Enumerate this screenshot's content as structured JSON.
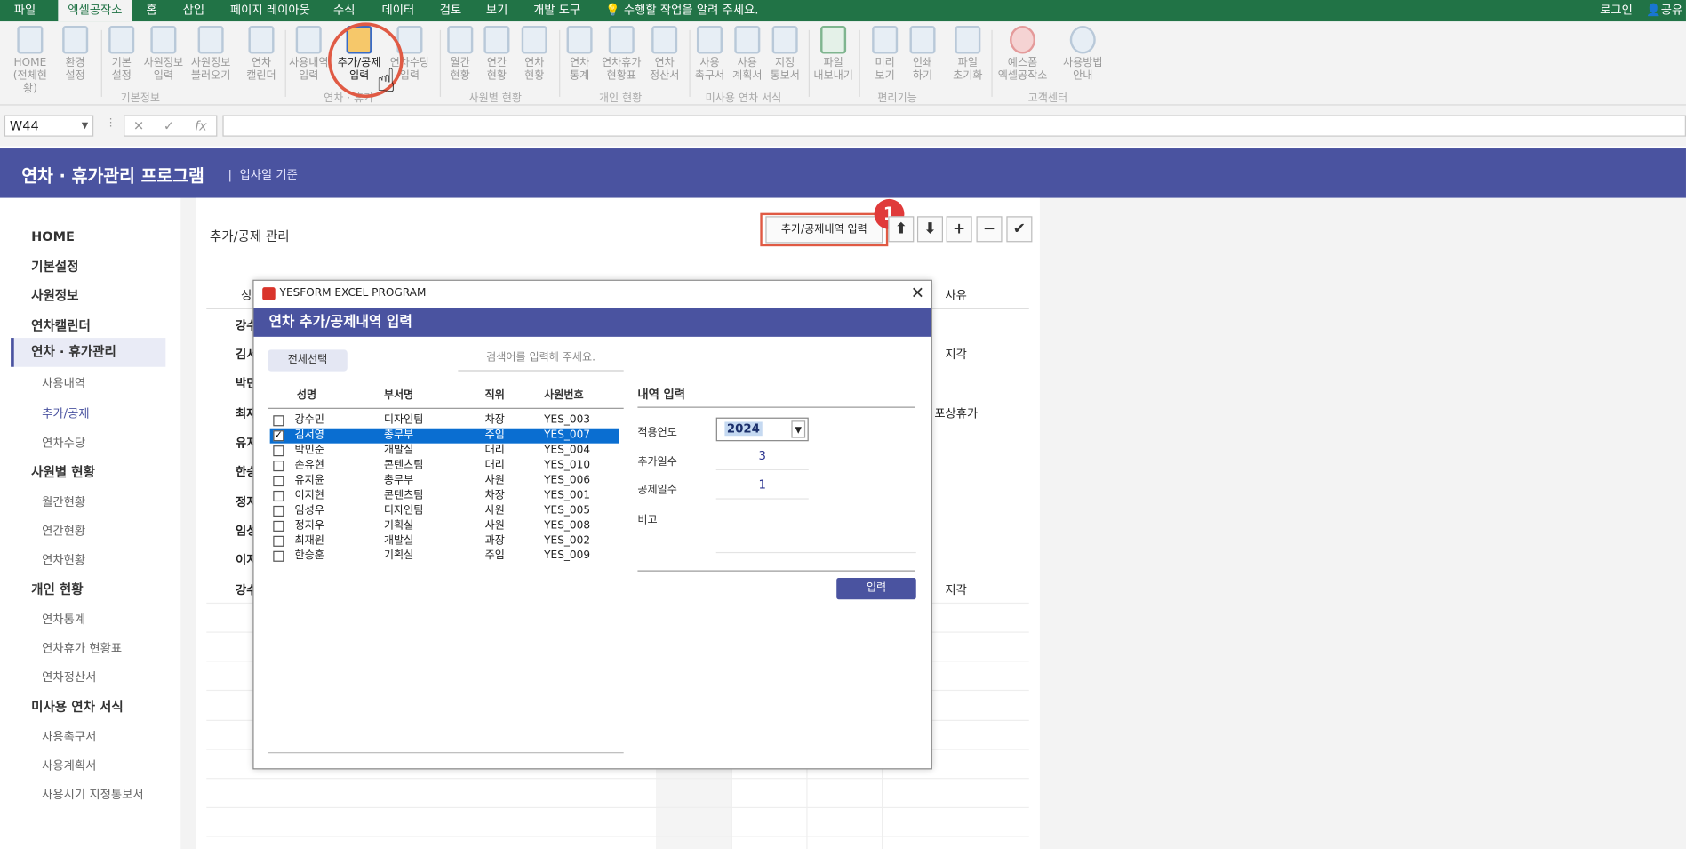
{
  "ribbon_tabs": [
    "파일",
    "엑셀공작소",
    "홈",
    "삽입",
    "페이지 레이아웃",
    "수식",
    "데이터",
    "검토",
    "보기",
    "개발 도구"
  ],
  "tell_me": "수행할 작업을 알려 주세요.",
  "login": "로그인",
  "share": "공유",
  "ribbon_buttons": [
    {
      "label": "HOME\n(전체현황)",
      "icon": "home-icon"
    },
    {
      "label": "환경\n설정",
      "icon": "gear-icon"
    },
    {
      "label": "기본\n설정",
      "icon": "settings-icon"
    },
    {
      "label": "사원정보\n입력",
      "icon": "users-icon"
    },
    {
      "label": "사원정보\n불러오기",
      "icon": "import-icon"
    },
    {
      "label": "연차\n캘린더",
      "icon": "calendar-icon"
    },
    {
      "label": "사용내역\n입력",
      "icon": "edit-icon"
    },
    {
      "label": "추가/공제\n입력",
      "icon": "edit-icon"
    },
    {
      "label": "연차수당\n입력",
      "icon": "edit-icon"
    },
    {
      "label": "월간\n현황",
      "icon": "table-icon"
    },
    {
      "label": "연간\n현황",
      "icon": "table-icon"
    },
    {
      "label": "연차\n현황",
      "icon": "users-icon"
    },
    {
      "label": "연차\n통계",
      "icon": "stats-icon"
    },
    {
      "label": "연차휴가\n현황표",
      "icon": "checklist-icon"
    },
    {
      "label": "연차\n정산서",
      "icon": "card-icon"
    },
    {
      "label": "사용\n촉구서",
      "icon": "doc-icon"
    },
    {
      "label": "사용\n계획서",
      "icon": "doc-icon"
    },
    {
      "label": "지정\n통보서",
      "icon": "doc-icon"
    },
    {
      "label": "파일\n내보내기",
      "icon": "excel-icon"
    },
    {
      "label": "미리\n보기",
      "icon": "preview-icon"
    },
    {
      "label": "인쇄\n하기",
      "icon": "print-icon"
    },
    {
      "label": "파일\n초기화",
      "icon": "trash-icon"
    },
    {
      "label": "예스폼\n엑셀공작소",
      "icon": "brand-icon"
    },
    {
      "label": "사용방법\n안내",
      "icon": "info-icon"
    }
  ],
  "ribbon_groups": [
    "기본정보",
    "연차 · 휴가",
    "사원별 현황",
    "개인 현황",
    "미사용 연차 서식",
    "편리기능",
    "고객센터"
  ],
  "name_box": "W44",
  "banner": {
    "title": "연차 · 휴가관리 프로그램",
    "sep": "|",
    "subtitle": "입사일 기준"
  },
  "sidebar": [
    {
      "label": "HOME",
      "level": 1
    },
    {
      "label": "기본설정",
      "level": 1
    },
    {
      "label": "사원정보",
      "level": 1
    },
    {
      "label": "연차캘린더",
      "level": 1
    },
    {
      "label": "연차 · 휴가관리",
      "level": 1,
      "selected": true
    },
    {
      "label": "사용내역",
      "level": 2
    },
    {
      "label": "추가/공제",
      "level": 2
    },
    {
      "label": "연차수당",
      "level": 2
    },
    {
      "label": "사원별 현황",
      "level": 1
    },
    {
      "label": "월간현황",
      "level": 2
    },
    {
      "label": "연간현황",
      "level": 2
    },
    {
      "label": "연차현황",
      "level": 2
    },
    {
      "label": "개인 현황",
      "level": 1
    },
    {
      "label": "연차통계",
      "level": 2
    },
    {
      "label": "연차휴가 현황표",
      "level": 2
    },
    {
      "label": "연차정산서",
      "level": 2
    },
    {
      "label": "미사용 연차 서식",
      "level": 1
    },
    {
      "label": "사용촉구서",
      "level": 2
    },
    {
      "label": "사용계획서",
      "level": 2
    },
    {
      "label": "사용시기 지정통보서",
      "level": 2
    }
  ],
  "main": {
    "title": "추가/공제 관리",
    "add_button": "추가/공제내역 입력",
    "badge": "1",
    "header_left": "성",
    "header_right": "사유",
    "bg_names": [
      "강수",
      "김서",
      "박민",
      "최재",
      "유지",
      "한승",
      "정지",
      "임성",
      "이지",
      "강수"
    ],
    "bg_reasons": [
      "지각",
      "포상휴가",
      "지각"
    ]
  },
  "dialog": {
    "window_title": "YESFORM EXCEL PROGRAM",
    "header": "연차 추가/공제내역 입력",
    "select_all": "전체선택",
    "search_placeholder": "검색어를 입력해 주세요.",
    "columns": [
      "성명",
      "부서명",
      "직위",
      "사원번호"
    ],
    "rows": [
      {
        "name": "강수민",
        "dept": "디자인팀",
        "pos": "차장",
        "id": "YES_003",
        "checked": false,
        "selected": false
      },
      {
        "name": "김서영",
        "dept": "총무부",
        "pos": "주임",
        "id": "YES_007",
        "checked": true,
        "selected": true
      },
      {
        "name": "박민준",
        "dept": "개발실",
        "pos": "대리",
        "id": "YES_004",
        "checked": false,
        "selected": false
      },
      {
        "name": "손유현",
        "dept": "콘텐츠팀",
        "pos": "대리",
        "id": "YES_010",
        "checked": false,
        "selected": false
      },
      {
        "name": "유지윤",
        "dept": "총무부",
        "pos": "사원",
        "id": "YES_006",
        "checked": false,
        "selected": false
      },
      {
        "name": "이지현",
        "dept": "콘텐츠팀",
        "pos": "차장",
        "id": "YES_001",
        "checked": false,
        "selected": false
      },
      {
        "name": "임성우",
        "dept": "디자인팀",
        "pos": "사원",
        "id": "YES_005",
        "checked": false,
        "selected": false
      },
      {
        "name": "정지우",
        "dept": "기획실",
        "pos": "사원",
        "id": "YES_008",
        "checked": false,
        "selected": false
      },
      {
        "name": "최재원",
        "dept": "개발실",
        "pos": "과장",
        "id": "YES_002",
        "checked": false,
        "selected": false
      },
      {
        "name": "한승훈",
        "dept": "기획실",
        "pos": "주임",
        "id": "YES_009",
        "checked": false,
        "selected": false
      }
    ],
    "detail_title": "내역 입력",
    "year_label": "적용연도",
    "year_value": "2024",
    "add_days_label": "추가일수",
    "add_days_value": "3",
    "deduct_days_label": "공제일수",
    "deduct_days_value": "1",
    "remark_label": "비고",
    "remark_value": "",
    "submit": "입력"
  }
}
